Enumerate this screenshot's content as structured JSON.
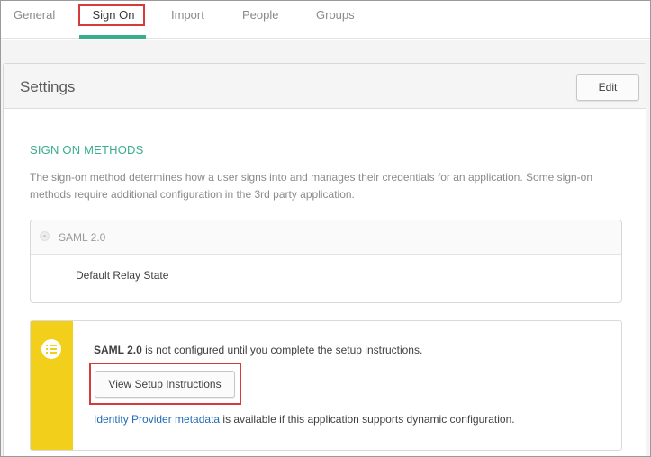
{
  "tabs": [
    {
      "label": "General"
    },
    {
      "label": "Sign On"
    },
    {
      "label": "Import"
    },
    {
      "label": "People"
    },
    {
      "label": "Groups"
    }
  ],
  "active_tab": "Sign On",
  "settings": {
    "title": "Settings",
    "edit_label": "Edit"
  },
  "sign_on": {
    "section_title": "SIGN ON METHODS",
    "description": "The sign-on method determines how a user signs into and manages their credentials for an application. Some sign-on methods require additional configuration in the 3rd party application.",
    "method_label": "SAML 2.0",
    "relay_state_label": "Default Relay State"
  },
  "notice": {
    "bold_text": "SAML 2.0",
    "text": " is not configured until you complete the setup instructions.",
    "button_label": "View Setup Instructions",
    "link_text": "Identity Provider metadata",
    "link_suffix": " is available if this application supports dynamic configuration.",
    "icon": "list-icon"
  },
  "colors": {
    "accent": "#3aad8d",
    "highlight_box": "#d63b3b",
    "notice_stripe": "#f1cf1a",
    "link": "#1f6cb8"
  }
}
